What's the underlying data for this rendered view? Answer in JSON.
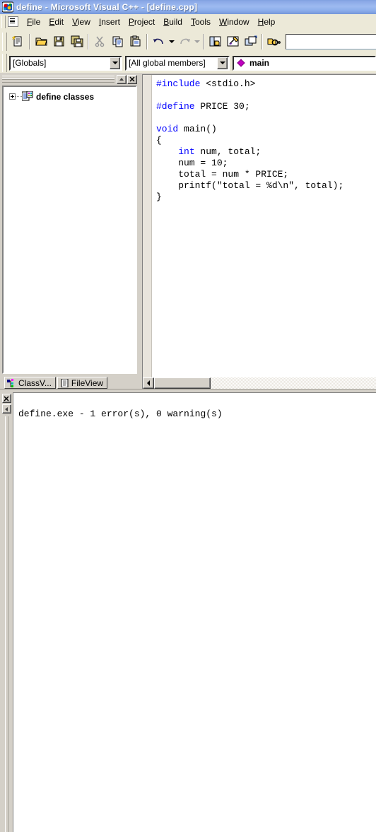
{
  "window": {
    "title": "define - Microsoft Visual C++ - [define.cpp]",
    "app_icon": "visual-cpp-icon",
    "title_color": "#ffffff",
    "titlebar_color": "#8fb0ec"
  },
  "menubar": {
    "system_icon": "document-system-icon",
    "items": [
      {
        "label": "File",
        "accel": "F"
      },
      {
        "label": "Edit",
        "accel": "E"
      },
      {
        "label": "View",
        "accel": "V"
      },
      {
        "label": "Insert",
        "accel": "I"
      },
      {
        "label": "Project",
        "accel": "P"
      },
      {
        "label": "Build",
        "accel": "B"
      },
      {
        "label": "Tools",
        "accel": "T"
      },
      {
        "label": "Window",
        "accel": "W"
      },
      {
        "label": "Help",
        "accel": "H"
      }
    ]
  },
  "toolbar": {
    "buttons": [
      {
        "name": "new-text-file-icon",
        "title": "New Text File"
      },
      {
        "name": "open-folder-icon",
        "title": "Open"
      },
      {
        "name": "save-icon",
        "title": "Save"
      },
      {
        "name": "save-all-icon",
        "title": "Save All"
      },
      {
        "name": "cut-scissors-icon",
        "title": "Cut"
      },
      {
        "name": "copy-icon",
        "title": "Copy"
      },
      {
        "name": "paste-clipboard-icon",
        "title": "Paste"
      },
      {
        "name": "undo-arrow-icon",
        "title": "Undo"
      },
      {
        "name": "redo-arrow-icon",
        "title": "Redo"
      },
      {
        "name": "workspace-window-icon",
        "title": "Workspace"
      },
      {
        "name": "output-window-icon",
        "title": "Output"
      },
      {
        "name": "window-list-icon",
        "title": "Window List"
      },
      {
        "name": "find-in-files-icon",
        "title": "Find in Files"
      }
    ],
    "find_value": "",
    "find_placeholder": ""
  },
  "wizardbar": {
    "class_combo": {
      "value": "[Globals]"
    },
    "member_combo": {
      "value": "[All global members]"
    },
    "symbol_combo": {
      "value": "main",
      "icon": "member-diamond-icon",
      "icon_color": "#c000c0"
    }
  },
  "workspace": {
    "minimize_label": "▲",
    "close_label": "✖",
    "tree": [
      {
        "label": "define classes",
        "icon": "class-folder-icon",
        "expander": "plus"
      }
    ],
    "tabs": [
      {
        "label": "ClassV...",
        "icon": "classview-icon",
        "active": true
      },
      {
        "label": "FileView",
        "icon": "fileview-icon",
        "active": false
      }
    ]
  },
  "editor": {
    "filename": "define.cpp",
    "lines": [
      [
        {
          "t": "#include",
          "c": "kw"
        },
        {
          "t": " <stdio.h>",
          "c": ""
        }
      ],
      [
        {
          "t": "",
          "c": ""
        }
      ],
      [
        {
          "t": "#define",
          "c": "kw"
        },
        {
          "t": " PRICE 30;",
          "c": ""
        }
      ],
      [
        {
          "t": "",
          "c": ""
        }
      ],
      [
        {
          "t": "void",
          "c": "kw"
        },
        {
          "t": " main()",
          "c": ""
        }
      ],
      [
        {
          "t": "{",
          "c": ""
        }
      ],
      [
        {
          "t": "    ",
          "c": ""
        },
        {
          "t": "int",
          "c": "kw"
        },
        {
          "t": " num, total;",
          "c": ""
        }
      ],
      [
        {
          "t": "    num = 10;",
          "c": ""
        }
      ],
      [
        {
          "t": "    total = num * PRICE;",
          "c": ""
        }
      ],
      [
        {
          "t": "    printf(\"total = %d\\n\", total);",
          "c": ""
        }
      ],
      [
        {
          "t": "}",
          "c": ""
        }
      ]
    ],
    "keyword_color": "#0000ff",
    "text_color": "#000000"
  },
  "output": {
    "close_label": "✖",
    "scroll_label": "◀",
    "lines": "define.exe - 1 error(s), 0 warning(s)"
  }
}
